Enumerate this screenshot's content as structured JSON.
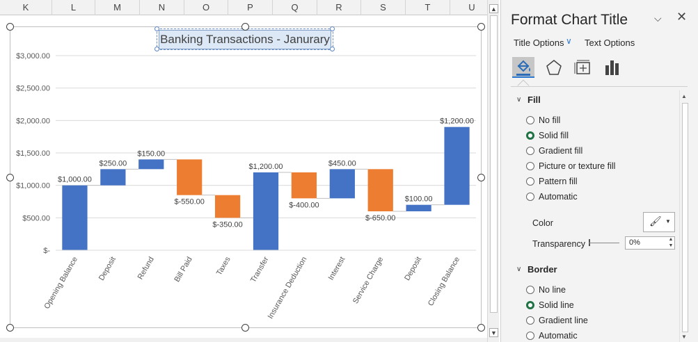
{
  "sheet": {
    "columns": [
      "K",
      "L",
      "M",
      "N",
      "O",
      "P",
      "Q",
      "R",
      "S",
      "T",
      "U"
    ]
  },
  "chart": {
    "title": "Banking Transactions - Janurary",
    "selected_element": "chart-title"
  },
  "chart_data": {
    "type": "bar",
    "subtype": "waterfall",
    "title": "Banking Transactions - Janurary",
    "xlabel": "",
    "ylabel": "",
    "ylim": [
      0,
      3000
    ],
    "y_ticks": [
      "$-",
      "$500.00",
      "$1,000.00",
      "$1,500.00",
      "$2,000.00",
      "$2,500.00",
      "$3,000.00"
    ],
    "grid": true,
    "categories": [
      "Opening Balance",
      "Deposit",
      "Refund",
      "Bill Paid",
      "Taxes",
      "Transfer",
      "Insurance Deduction",
      "Interest",
      "Service Charge",
      "Deposit",
      "Closing Balance"
    ],
    "values": [
      1000,
      250,
      150,
      -550,
      -350,
      1200,
      -400,
      450,
      -650,
      100,
      1200
    ],
    "bar_kind": [
      "total",
      "delta",
      "delta",
      "delta",
      "delta",
      "total",
      "delta",
      "delta",
      "delta",
      "delta",
      "delta"
    ],
    "labels": [
      "$1,000.00",
      "$250.00",
      "$150.00",
      "$-550.00",
      "$-350.00",
      "$1,200.00",
      "$-400.00",
      "$450.00",
      "$-650.00",
      "$100.00",
      "$1,200.00"
    ],
    "colors": {
      "increase": "#4472c4",
      "decrease": "#ed7d31"
    }
  },
  "pane": {
    "title": "Format Chart Title",
    "tab_title_options": "Title Options",
    "tab_text_options": "Text Options",
    "icons": [
      "fill-line-icon",
      "effects-icon",
      "size-properties-icon",
      "chart-options-icon"
    ],
    "fill": {
      "heading": "Fill",
      "options": [
        "No fill",
        "Solid fill",
        "Gradient fill",
        "Picture or texture fill",
        "Pattern fill",
        "Automatic"
      ],
      "selected": "Solid fill",
      "color_label": "Color",
      "transparency_label": "Transparency",
      "transparency_value": "0%"
    },
    "border": {
      "heading": "Border",
      "options": [
        "No line",
        "Solid line",
        "Gradient line",
        "Automatic"
      ],
      "selected": "Solid line"
    }
  }
}
